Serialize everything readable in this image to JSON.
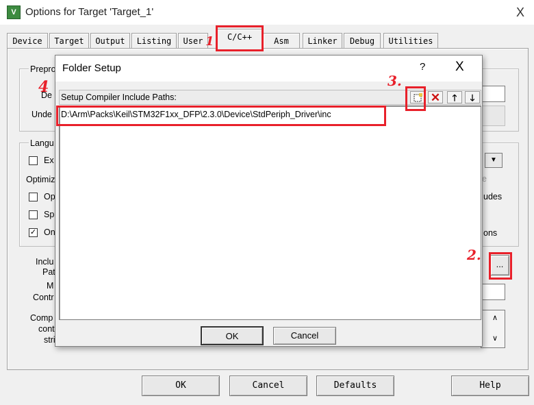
{
  "window": {
    "title": "Options for Target 'Target_1'",
    "close_glyph": "X"
  },
  "tabs": [
    {
      "label": "Device"
    },
    {
      "label": "Target"
    },
    {
      "label": "Output"
    },
    {
      "label": "Listing"
    },
    {
      "label": "User"
    },
    {
      "label": "C/C++"
    },
    {
      "label": "Asm"
    },
    {
      "label": "Linker"
    },
    {
      "label": "Debug"
    },
    {
      "label": "Utilities"
    }
  ],
  "partial_labels": {
    "prepro": "Prepro",
    "de": "De",
    "unde": "Unde",
    "langu": "Langu",
    "ex": "Ex",
    "optimiz": "Optimiz",
    "op": "Op",
    "sp": "Sp",
    "on": "On",
    "e": "e",
    "udes": "udes",
    "ons": "ons",
    "inclu": "Inclu",
    "pat": "Pat",
    "m": "M",
    "contr": "Contr",
    "comp": "Comp",
    "cont": "cont",
    "stri": "stri"
  },
  "dialog": {
    "title": "Folder Setup",
    "help_glyph": "?",
    "close_glyph": "X",
    "list_label": "Setup Compiler Include Paths:",
    "paths": [
      "D:\\Arm\\Packs\\Keil\\STM32F1xx_DFP\\2.3.0\\Device\\StdPeriph_Driver\\inc"
    ],
    "ok_label": "OK",
    "cancel_label": "Cancel"
  },
  "browse_button_label": "...",
  "bottom_buttons": {
    "ok": "OK",
    "cancel": "Cancel",
    "defaults": "Defaults",
    "help": "Help"
  },
  "annotations": {
    "step1": "1",
    "step2": "2.",
    "step3": "3.",
    "step4": "4"
  },
  "colors": {
    "annotation_red": "#e8202a",
    "dialog_bg": "#f0f0f0",
    "delete_red": "#cc1111"
  }
}
